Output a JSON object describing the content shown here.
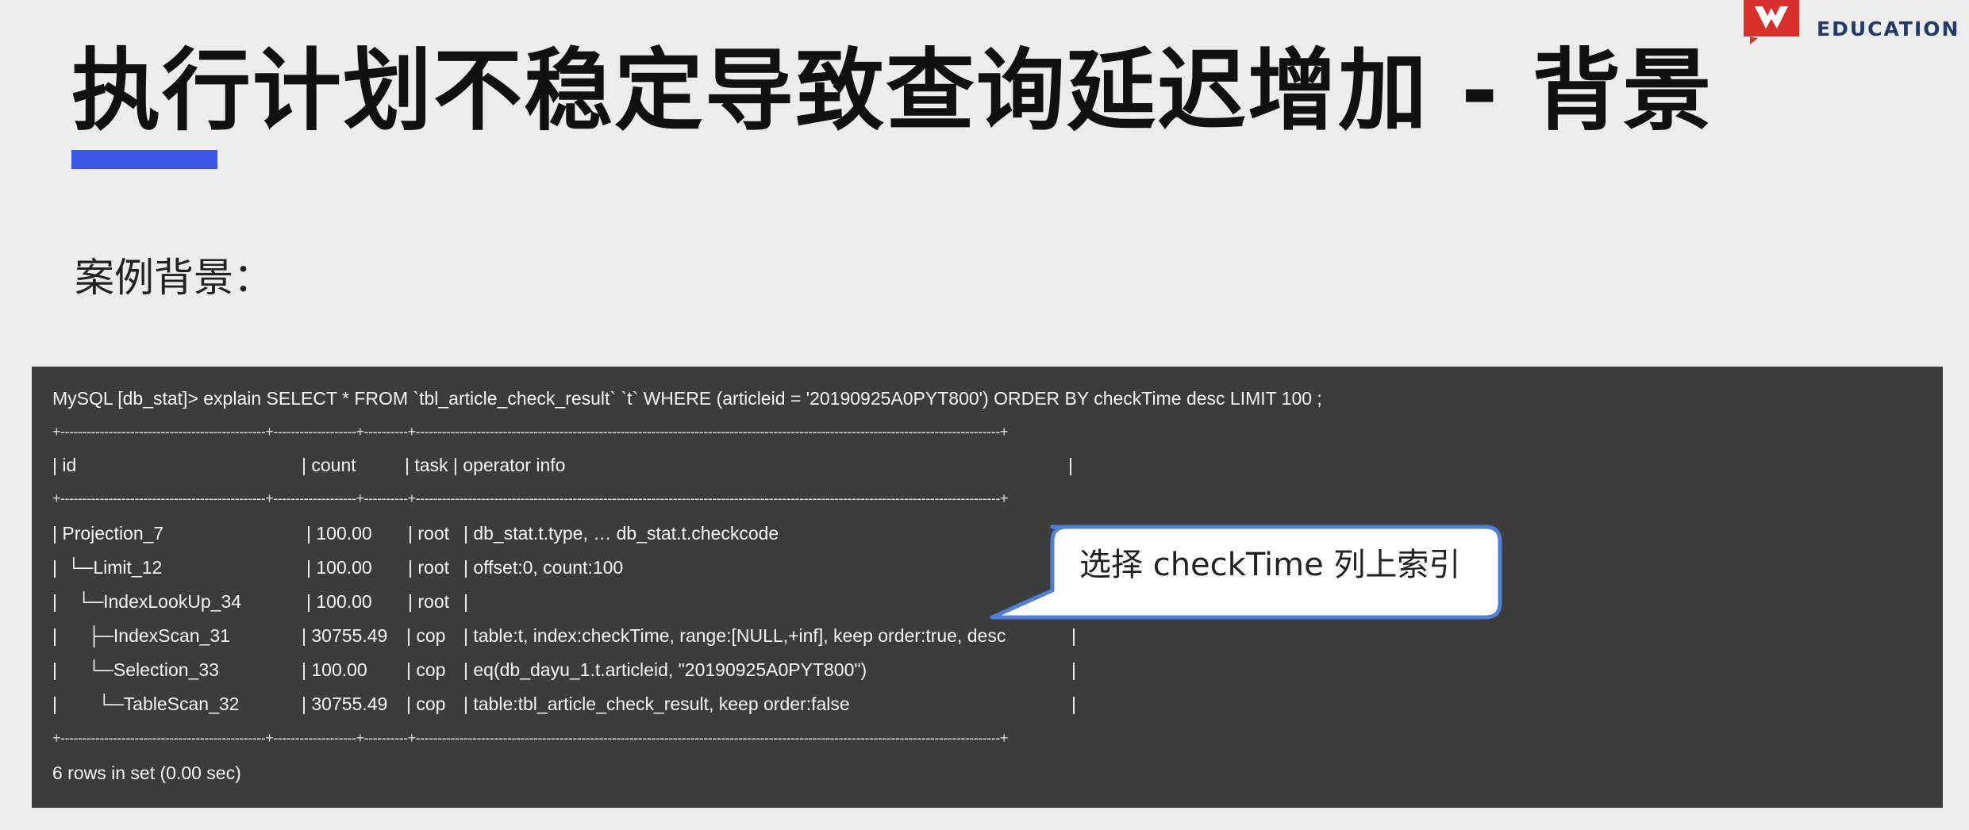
{
  "title": "执行计划不稳定导致查询延迟增加 - 背景",
  "colors": {
    "accent": "#3a57e8",
    "logo_red": "#d9302b",
    "logo_text": "#233a66",
    "terminal_bg": "#3c3c3c",
    "callout_border": "#4f7fd6"
  },
  "logo": {
    "text": "EDUCATION",
    "icon": "pingcap-logo-icon"
  },
  "section_label": "案例背景：",
  "terminal": {
    "command": "MySQL [db_stat]> explain SELECT * FROM `tbl_article_check_result` `t` WHERE (articleid = '20190925A0PYT800') ORDER BY checkTime desc LIMIT 100 ;",
    "separator": "+-----------------------------------------------+-------------------+----------+--------------------------------------------------------------------------------------------------------------------------------------+",
    "header": {
      "id": "| id",
      "count": "| count",
      "task": "| task | operator info",
      "end": "|"
    },
    "rows": [
      {
        "id": "| Projection_7",
        "count": "| 100.00",
        "task": "| root",
        "info": "| db_stat.t.type, … db_stat.t.checkcode",
        "end": ""
      },
      {
        "id": "|  └─Limit_12",
        "count": "| 100.00",
        "task": "| root",
        "info": "| offset:0, count:100",
        "end": ""
      },
      {
        "id": "|    └─IndexLookUp_34",
        "count": "| 100.00",
        "task": "| root",
        "info": "|",
        "end": ""
      },
      {
        "id": "|      ├─IndexScan_31",
        "count": "| 30755.49",
        "task": "| cop",
        "info": "| table:t, index:checkTime, range:[NULL,+inf], keep order:true, desc",
        "end": "|"
      },
      {
        "id": "|      └─Selection_33",
        "count": "| 100.00",
        "task": "| cop",
        "info": "| eq(db_dayu_1.t.articleid, \"20190925A0PYT800\")",
        "end": "|"
      },
      {
        "id": "|        └─TableScan_32",
        "count": "| 30755.49",
        "task": "| cop",
        "info": "| table:tbl_article_check_result, keep order:false",
        "end": "|"
      }
    ],
    "footer": "6 rows in set (0.00 sec)"
  },
  "callout": {
    "text": "选择 checkTime 列上索引"
  }
}
